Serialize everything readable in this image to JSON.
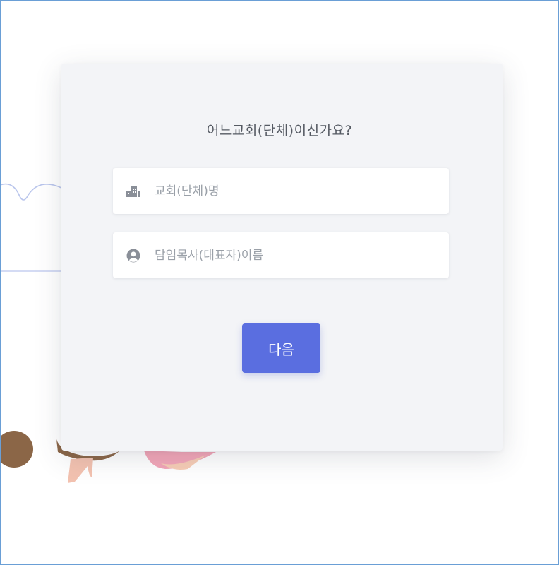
{
  "card": {
    "title": "어느교회(단체)이신가요?"
  },
  "fields": {
    "church_name": {
      "icon": "building-icon",
      "placeholder": "교회(단체)명",
      "value": ""
    },
    "pastor_name": {
      "icon": "user-circle-icon",
      "placeholder": "담임목사(대표자)이름",
      "value": ""
    }
  },
  "actions": {
    "next_label": "다음"
  },
  "colors": {
    "accent": "#5a6ee0",
    "card_background": "#f3f4f7",
    "frame_border": "#6a9fd6",
    "title_text": "#555a63",
    "placeholder_text": "#9aa0a8"
  }
}
